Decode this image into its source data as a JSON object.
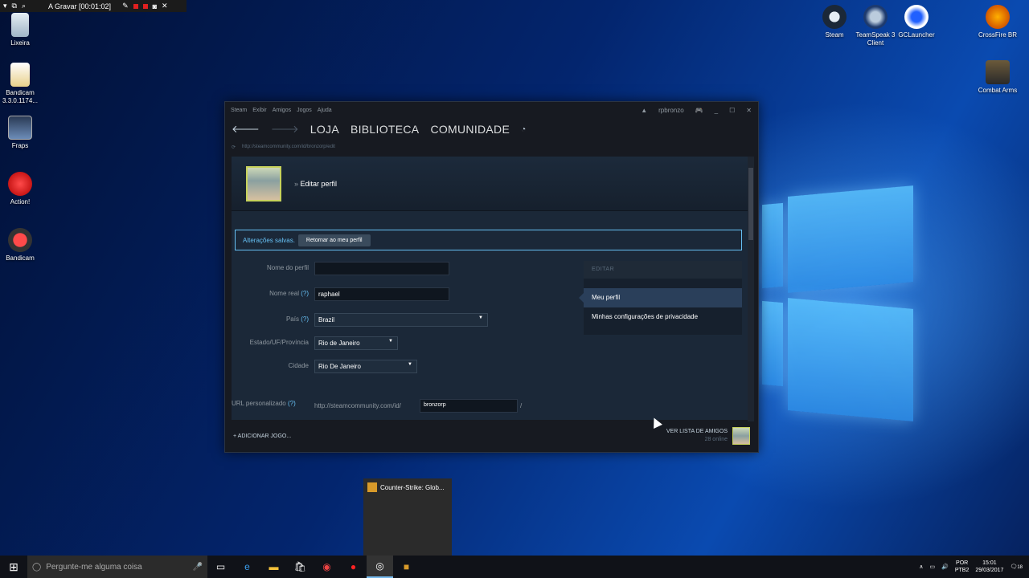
{
  "recorder": {
    "title": "A Gravar [00:01:02]"
  },
  "desktop_icons_left": [
    {
      "label": "Lixeira"
    },
    {
      "label": "Bandicam\n3.3.0.1174..."
    },
    {
      "label": "Fraps"
    },
    {
      "label": "Action!"
    },
    {
      "label": "Bandicam"
    }
  ],
  "desktop_icons_right": [
    {
      "label": "Steam"
    },
    {
      "label": "TeamSpeak 3 Client"
    },
    {
      "label": "GCLauncher"
    },
    {
      "label": "CrossFire BR"
    },
    {
      "label": "Combat Arms"
    }
  ],
  "steam": {
    "menu": [
      "Steam",
      "Exibir",
      "Amigos",
      "Jogos",
      "Ajuda"
    ],
    "username": "rpbronzo",
    "nav": [
      "LOJA",
      "BIBLIOTECA",
      "COMUNIDADE"
    ],
    "url": "http://steamcommunity.com/id/bronzorp/edit",
    "breadcrumb_sep": "»",
    "breadcrumb": "Editar perfil",
    "saved_msg": "Alterações salvas.",
    "return_btn": "Retornar ao meu perfil",
    "fields": {
      "profile_name_label": "Nome do perfil",
      "profile_name_value": "",
      "real_name_label": "Nome real",
      "real_name_value": "raphael",
      "country_label": "País",
      "country_value": "Brazil",
      "state_label": "Estado/UF/Província",
      "state_value": "Rio de Janeiro",
      "city_label": "Cidade",
      "city_value": "Rio De Janeiro",
      "custom_url_label": "URL personalizado",
      "custom_url_prefix": "http://steamcommunity.com/id/",
      "custom_url_value": "bronzorp",
      "custom_url_suffix": "/",
      "help": "(?)"
    },
    "side": {
      "header": "EDITAR",
      "items": [
        "Meu perfil",
        "Minhas configurações de privacidade"
      ]
    },
    "add_game": "ADICIONAR JOGO...",
    "friends_list": "VER LISTA DE AMIGOS",
    "friends_online": "28 online"
  },
  "preview": {
    "title": "Counter-Strike: Glob..."
  },
  "taskbar": {
    "search_placeholder": "Pergunte-me alguma coisa",
    "lang": "POR",
    "layout": "PTB2",
    "time": "15:01",
    "date": "29/03/2017",
    "notifications": "18"
  }
}
